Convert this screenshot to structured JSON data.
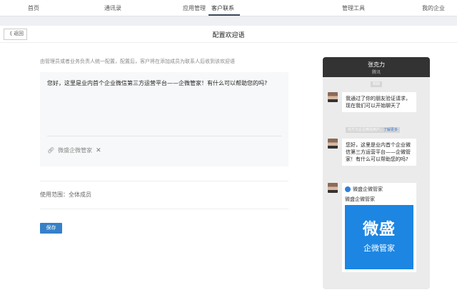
{
  "nav": {
    "items": [
      "首页",
      "通讯录",
      "应用管理",
      "客户联系",
      "管理工具",
      "我的企业"
    ],
    "active": 3
  },
  "header": {
    "back": "《 返回",
    "title": "配置欢迎语"
  },
  "form": {
    "description": "由管理员或者业务负责人统一配置，配置后，客户将在添加成员为联系人后收到该欢迎语",
    "message": "您好，这里是业内首个企业微信第三方运营平台——企微管家！有什么可以帮助您的吗?",
    "attachment": "微盛企微管家",
    "scope": "使用范围：全体成员",
    "save": "保存"
  },
  "preview": {
    "name": "张克力",
    "company": "腾讯",
    "time": "刚刚",
    "msg1": "我通过了你的朋友验证请求，现在我们可以开始聊天了",
    "notice": "对方为企业微信用户，",
    "notice_link": "了解更多",
    "msg2": "您好，这里是业内首个企业微信第三方运营平台——企微管家！有什么可以帮助您的吗?",
    "card_source": "微盛企微管家",
    "card_title": "微盛企微管家",
    "card_logo_big": "微盛",
    "card_logo_small": "企微管家"
  }
}
